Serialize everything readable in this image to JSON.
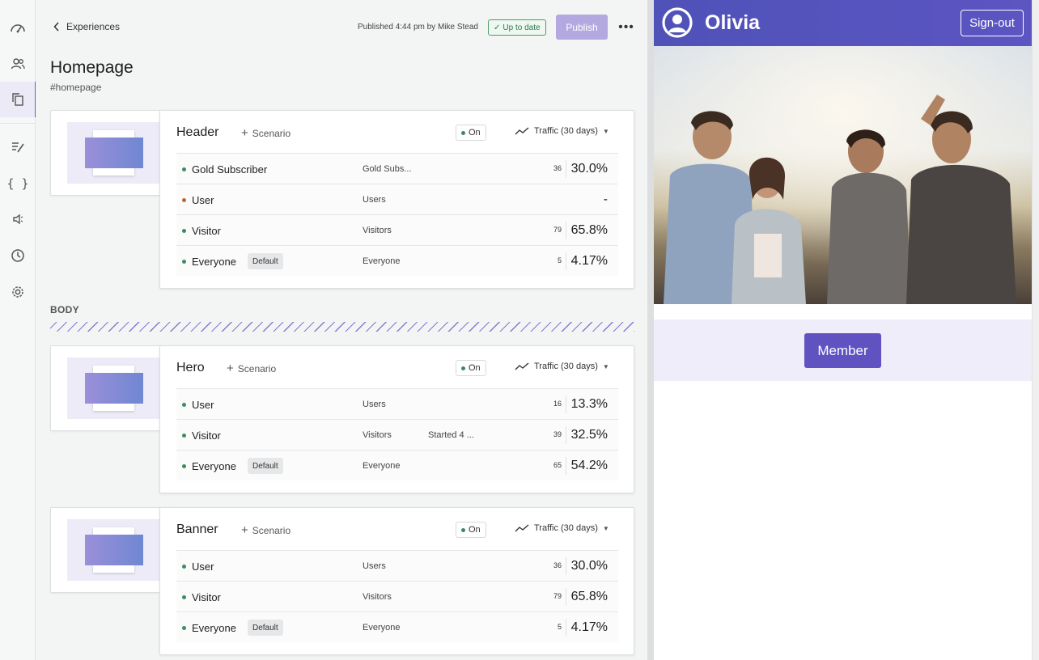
{
  "nav": {
    "items": [
      {
        "icon": "dashboard-gauge-icon"
      },
      {
        "icon": "people-icon"
      },
      {
        "icon": "copy-pages-icon",
        "active": true
      },
      {
        "icon": "edit-list-icon"
      },
      {
        "icon": "code-braces-icon"
      },
      {
        "icon": "speaker-icon"
      },
      {
        "icon": "clock-icon"
      },
      {
        "icon": "gear-icon"
      }
    ]
  },
  "topbar": {
    "back_label": "Experiences",
    "published_info": "Published 4:44 pm by Mike Stead",
    "status_badge": "Up to date",
    "publish_label": "Publish"
  },
  "page": {
    "title": "Homepage",
    "slug": "#homepage",
    "section_label": "BODY"
  },
  "cards": [
    {
      "title": "Header",
      "scenario_label": "Scenario",
      "status": "On",
      "traffic_label": "Traffic (30 days)",
      "rows": [
        {
          "segment": "Gold Subscriber",
          "audience": "Gold Subs...",
          "started": "",
          "count": "36",
          "percent": "30.0%",
          "dot": "green"
        },
        {
          "segment": "User",
          "audience": "Users",
          "started": "",
          "count": "",
          "percent": "-",
          "dot": "orange"
        },
        {
          "segment": "Visitor",
          "audience": "Visitors",
          "started": "",
          "count": "79",
          "percent": "65.8%",
          "dot": "green"
        },
        {
          "segment": "Everyone",
          "default_tag": "Default",
          "audience": "Everyone",
          "started": "",
          "count": "5",
          "percent": "4.17%",
          "dot": "green"
        }
      ]
    },
    {
      "title": "Hero",
      "scenario_label": "Scenario",
      "status": "On",
      "traffic_label": "Traffic (30 days)",
      "rows": [
        {
          "segment": "User",
          "audience": "Users",
          "started": "",
          "count": "16",
          "percent": "13.3%",
          "dot": "green"
        },
        {
          "segment": "Visitor",
          "audience": "Visitors",
          "started": "Started 4 ...",
          "count": "39",
          "percent": "32.5%",
          "dot": "green"
        },
        {
          "segment": "Everyone",
          "default_tag": "Default",
          "audience": "Everyone",
          "started": "",
          "count": "65",
          "percent": "54.2%",
          "dot": "green"
        }
      ]
    },
    {
      "title": "Banner",
      "scenario_label": "Scenario",
      "status": "On",
      "traffic_label": "Traffic (30 days)",
      "rows": [
        {
          "segment": "User",
          "audience": "Users",
          "started": "",
          "count": "36",
          "percent": "30.0%",
          "dot": "green"
        },
        {
          "segment": "Visitor",
          "audience": "Visitors",
          "started": "",
          "count": "79",
          "percent": "65.8%",
          "dot": "green"
        },
        {
          "segment": "Everyone",
          "default_tag": "Default",
          "audience": "Everyone",
          "started": "",
          "count": "5",
          "percent": "4.17%",
          "dot": "green"
        }
      ]
    }
  ],
  "preview": {
    "brand": "Olivia",
    "signout_label": "Sign-out",
    "member_label": "Member"
  },
  "colors": {
    "accent": "#6a5fc1",
    "publish_disabled": "#b3a9e0",
    "status_green": "#3e8b5e",
    "status_orange": "#c1652b",
    "preview_header": "#5452bd",
    "member_button": "#6052c0"
  }
}
